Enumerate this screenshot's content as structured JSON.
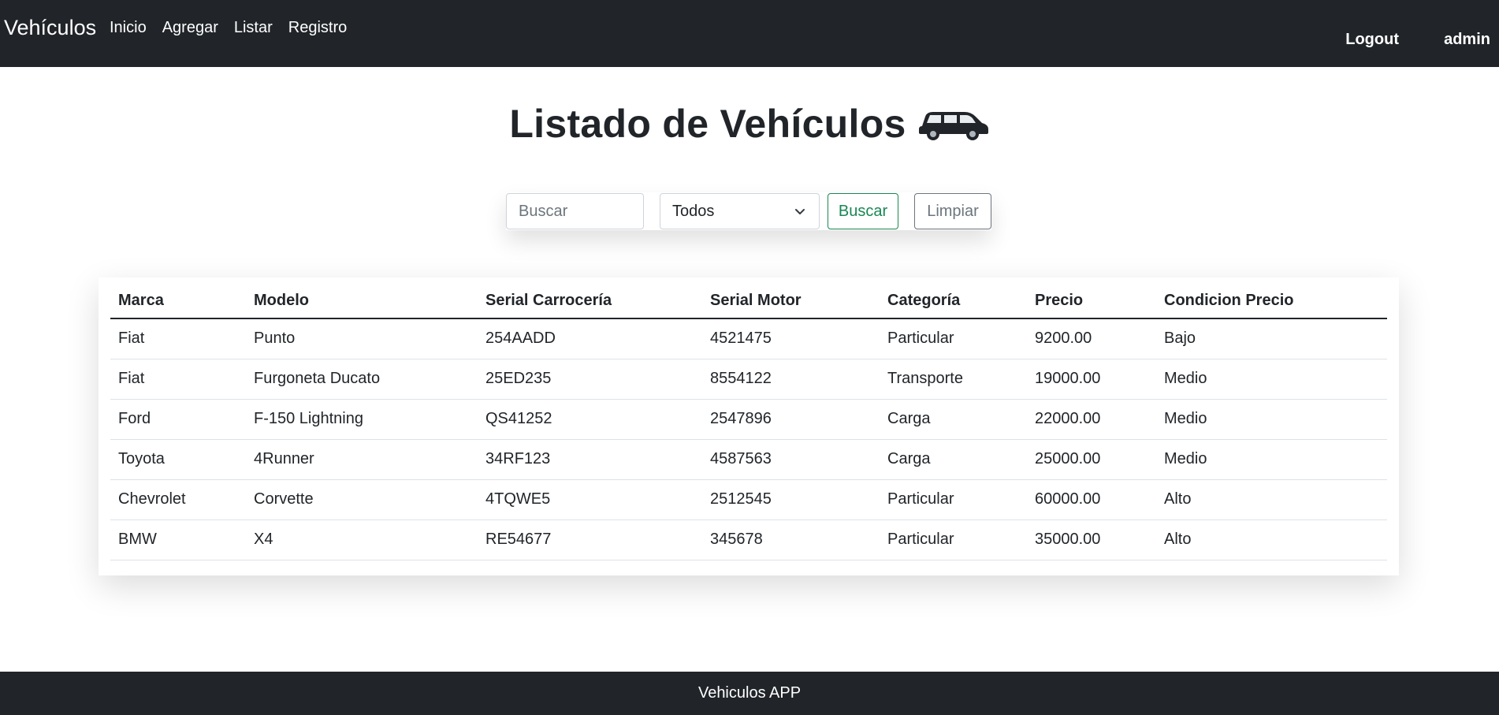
{
  "navbar": {
    "brand": "Vehículos",
    "links": [
      "Inicio",
      "Agregar",
      "Listar",
      "Registro"
    ],
    "logout": "Logout",
    "user": "admin"
  },
  "page": {
    "title": "Listado de Vehículos",
    "title_icon": "car-icon"
  },
  "search": {
    "placeholder": "Buscar",
    "value": "",
    "filter_selected": "Todos",
    "buscar_label": "Buscar",
    "limpiar_label": "Limpiar"
  },
  "table": {
    "headers": [
      "Marca",
      "Modelo",
      "Serial Carrocería",
      "Serial Motor",
      "Categoría",
      "Precio",
      "Condicion Precio"
    ],
    "rows": [
      [
        "Fiat",
        "Punto",
        "254AADD",
        "4521475",
        "Particular",
        "9200.00",
        "Bajo"
      ],
      [
        "Fiat",
        "Furgoneta Ducato",
        "25ED235",
        "8554122",
        "Transporte",
        "19000.00",
        "Medio"
      ],
      [
        "Ford",
        "F-150 Lightning",
        "QS41252",
        "2547896",
        "Carga",
        "22000.00",
        "Medio"
      ],
      [
        "Toyota",
        "4Runner",
        "34RF123",
        "4587563",
        "Carga",
        "25000.00",
        "Medio"
      ],
      [
        "Chevrolet",
        "Corvette",
        "4TQWE5",
        "2512545",
        "Particular",
        "60000.00",
        "Alto"
      ],
      [
        "BMW",
        "X4",
        "RE54677",
        "345678",
        "Particular",
        "35000.00",
        "Alto"
      ]
    ]
  },
  "footer": {
    "text": "Vehiculos APP"
  },
  "colors": {
    "navbar_bg": "#212529",
    "success": "#198754",
    "secondary": "#6c757d"
  }
}
